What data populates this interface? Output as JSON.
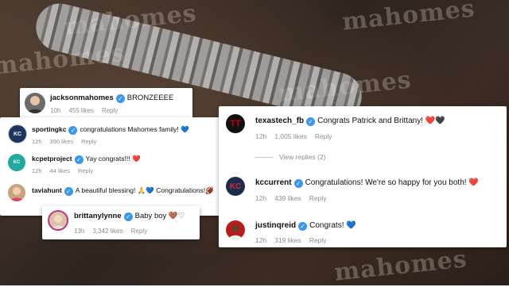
{
  "comments_left": [
    {
      "user": "sportingkc",
      "text": "congratulations Mahomes family!",
      "emoji": "💙",
      "emoji_class": "heart-blue",
      "time": "12h",
      "likes": "390 likes",
      "reply": "Reply",
      "avatar_color": "#1c355e"
    },
    {
      "user": "kcpetproject",
      "text": "Yay congrats!!!",
      "emoji": "❤️",
      "emoji_class": "heart-red",
      "time": "12h",
      "likes": "44 likes",
      "reply": "Reply",
      "avatar_color": "#1faa9e"
    },
    {
      "user": "taviahunt",
      "text": "A beautiful blessing!",
      "emoji": "🙏💙 Congratulations!🏈",
      "emoji_class": "heart-blue",
      "time": "",
      "likes": "",
      "reply": "",
      "avatar_color": "#c9a27e"
    }
  ],
  "top_comment": {
    "user": "jacksonmahomes",
    "text": "BRONZEEEE",
    "time": "10h",
    "likes": "455 likes",
    "reply": "Reply"
  },
  "brittany_comment": {
    "user": "brittanylynne",
    "text": "Baby boy",
    "emoji1": "🤎",
    "emoji2": "♡",
    "time": "13h",
    "likes": "3,342 likes",
    "reply": "Reply"
  },
  "right_comments": [
    {
      "user": "texastech_fb",
      "text": "Congrats Patrick and Brittany!",
      "emoji1": "❤️",
      "emoji2": "🖤",
      "time": "12h",
      "likes": "1,005 likes",
      "reply": "Reply",
      "avatar_color": "#111111"
    },
    {
      "user": "kccurrent",
      "text": "Congratulations! We're so happy for you both!",
      "emoji1": "❤️",
      "emoji2": "",
      "time": "12h",
      "likes": "439 likes",
      "reply": "Reply",
      "avatar_color": "#1a2d4f"
    },
    {
      "user": "justinqreid",
      "text": "Congrats!",
      "emoji1": "💙",
      "emoji2": "",
      "time": "12h",
      "likes": "319 likes",
      "reply": "Reply",
      "avatar_color": "#b91c1c"
    }
  ],
  "view_replies": "View replies (2)",
  "watermark": "mahomes"
}
